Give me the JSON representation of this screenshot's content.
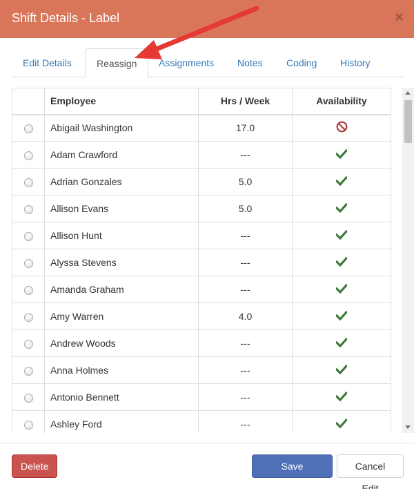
{
  "header": {
    "title": "Shift Details - Label",
    "close_glyph": "×"
  },
  "tabs": [
    {
      "label": "Edit Details"
    },
    {
      "label": "Reassign"
    },
    {
      "label": "Assignments"
    },
    {
      "label": "Notes"
    },
    {
      "label": "Coding"
    },
    {
      "label": "History"
    }
  ],
  "table": {
    "headers": [
      "Employee",
      "Hrs / Week",
      "Availability"
    ],
    "rows": [
      {
        "name": "Abigail Washington",
        "hrs": "17.0",
        "availability": "unavailable"
      },
      {
        "name": "Adam Crawford",
        "hrs": "---",
        "availability": "available"
      },
      {
        "name": "Adrian Gonzales",
        "hrs": "5.0",
        "availability": "available"
      },
      {
        "name": "Allison Evans",
        "hrs": "5.0",
        "availability": "available"
      },
      {
        "name": "Allison Hunt",
        "hrs": "---",
        "availability": "available"
      },
      {
        "name": "Alyssa Stevens",
        "hrs": "---",
        "availability": "available"
      },
      {
        "name": "Amanda Graham",
        "hrs": "---",
        "availability": "available"
      },
      {
        "name": "Amy Warren",
        "hrs": "4.0",
        "availability": "available"
      },
      {
        "name": "Andrew Woods",
        "hrs": "---",
        "availability": "available"
      },
      {
        "name": "Anna Holmes",
        "hrs": "---",
        "availability": "available"
      },
      {
        "name": "Antonio Bennett",
        "hrs": "---",
        "availability": "available"
      },
      {
        "name": "Ashley Ford",
        "hrs": "---",
        "availability": "available"
      }
    ]
  },
  "footer": {
    "delete_label": "Delete",
    "save_label": "Save Changes",
    "cancel_label": "Cancel Edit"
  },
  "colors": {
    "header_bg": "#d9765a",
    "check_green": "#3f7a3a",
    "unavailable_red": "#b03a3a",
    "annotation_arrow": "#e53935"
  },
  "icons": {
    "available": "check-icon",
    "unavailable": "prohibited-icon"
  }
}
